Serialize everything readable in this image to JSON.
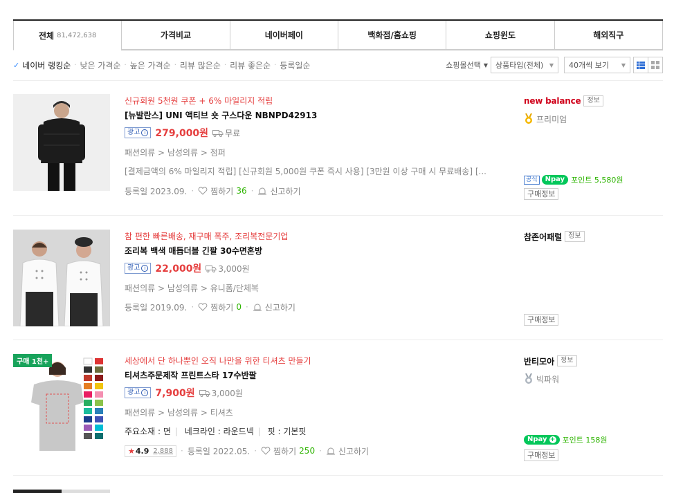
{
  "tabs": [
    {
      "label": "전체",
      "count": "81,472,638"
    },
    {
      "label": "가격비교"
    },
    {
      "label": "네이버페이"
    },
    {
      "label": "백화점/홈쇼핑"
    },
    {
      "label": "쇼핑윈도"
    },
    {
      "label": "해외직구"
    }
  ],
  "sort": {
    "items": [
      "네이버 랭킹순",
      "낮은 가격순",
      "높은 가격순",
      "리뷰 많은순",
      "리뷰 좋은순",
      "등록일순"
    ],
    "active_index": 0,
    "mall_select": "쇼핑몰선택",
    "product_type": "상품타입(전체)",
    "per_page": "40개씩 보기"
  },
  "products": [
    {
      "promo": "신규회원 5천원 쿠폰 + 6% 마일리지 적립",
      "title": "[뉴발란스] UNI 액티브 숏 구스다운 NBNPD42913",
      "ad_label": "광고",
      "price": "279,000원",
      "shipping": "무료",
      "category": "패션의류 > 남성의류 > 점퍼",
      "desc": "[결제금액의 6% 마일리지 적립] [신규회원 5,000원 쿠폰 즉시 사용] [3만원 이상 구매 시 무료배송] [...",
      "registered": "등록일 2023.09.",
      "wish_label": "찜하기",
      "wish_count": "36",
      "report_label": "신고하기",
      "mall_name": "new balance",
      "info_label": "정보",
      "grade": "프리미엄",
      "official_label": "공식",
      "npay_label": "pay",
      "points": "포인트 5,580원",
      "buy_info": "구매정보"
    },
    {
      "promo": "참 편한 빠른배송, 재구매 폭주, 조리복전문기업",
      "title": "조리복 백색 매듭더블 긴팔 30수면혼방",
      "ad_label": "광고",
      "price": "22,000원",
      "shipping": "3,000원",
      "category": "패션의류 > 남성의류 > 유니폼/단체복",
      "registered": "등록일 2019.09.",
      "wish_label": "찜하기",
      "wish_count": "0",
      "report_label": "신고하기",
      "mall_name": "참존어패럴",
      "info_label": "정보",
      "buy_info": "구매정보"
    },
    {
      "sticker": "구매 1천+",
      "promo": "세상에서 단 하나뿐인 오직 나만을 위한 티셔츠 만들기",
      "title": "티셔츠주문제작 프린트스타 17수반팔",
      "ad_label": "광고",
      "price": "7,900원",
      "shipping": "3,000원",
      "category": "패션의류 > 남성의류 > 티셔츠",
      "specs": [
        "주요소재 : 면",
        "네크라인 : 라운드넥",
        "핏 : 기본핏"
      ],
      "rating": "4.9",
      "review_count": "2,888",
      "registered": "등록일 2022.05.",
      "wish_label": "찜하기",
      "wish_count": "250",
      "report_label": "신고하기",
      "mall_name": "반티모아",
      "info_label": "정보",
      "grade": "빅파워",
      "npay_label": "pay",
      "points": "포인트 158원",
      "buy_info": "구매정보"
    }
  ],
  "colors": {
    "accent_red": "#e53e3e",
    "naver_green": "#03c75a",
    "ad_blue": "#2d5bb4",
    "sticker_green": "#18a35b"
  }
}
